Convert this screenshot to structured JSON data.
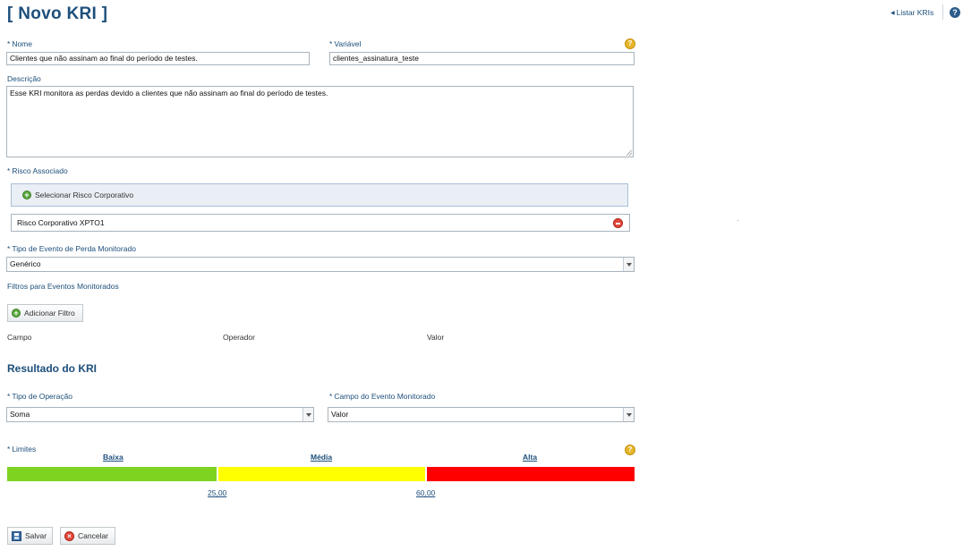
{
  "page_title": "[ Novo KRI ]",
  "top_link": "Listar KRIs",
  "help_top": "?",
  "fields": {
    "nome_label": "Nome",
    "nome_value": "Clientes que não assinam ao final do período de testes.",
    "variavel_label": "Variável",
    "variavel_value": "clientes_assinatura_teste",
    "descricao_label": "Descrição",
    "descricao_value": "Esse KRI monitora as perdas devido a clientes que não assinam ao final do período de testes.",
    "risco_label": "Risco Associado",
    "selecionar_risco_label": "Selecionar Risco Corporativo",
    "risco_item": "Risco Corporativo XPTO1",
    "tipo_evento_label": "Tipo de Evento de Perda Monitorado",
    "tipo_evento_value": "Genérico",
    "filtros_label": "Filtros para Eventos Monitorados",
    "adicionar_filtro_label": "Adicionar Filtro",
    "filter_columns": [
      "Campo",
      "Operador",
      "Valor"
    ]
  },
  "resultado": {
    "section_title": "Resultado do KRI",
    "tipo_operacao_label": "Tipo de Operação",
    "tipo_operacao_value": "Soma",
    "campo_evento_label": "Campo do Evento Monitorado",
    "campo_evento_value": "Valor",
    "limites_label": "Limites",
    "levels": [
      {
        "label": "Baixa",
        "color": "#7ed321"
      },
      {
        "label": "Média",
        "color": "#ffff00"
      },
      {
        "label": "Alta",
        "color": "#ff0000"
      }
    ],
    "thresholds": [
      "25,00",
      "60,00"
    ]
  },
  "actions": {
    "save_label": "Salvar",
    "cancel_label": "Cancelar"
  }
}
